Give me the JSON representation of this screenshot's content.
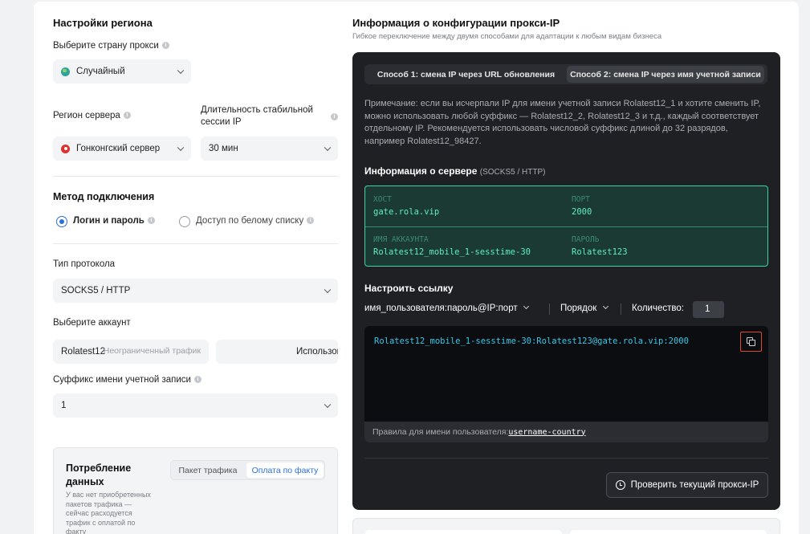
{
  "left": {
    "region_title": "Настройки региона",
    "country_label": "Выберите страну прокси",
    "country_value": "Случайный",
    "server_region_label": "Регион сервера",
    "server_region_value": "Гонконгский сервер",
    "session_label_1": "Длительность стабильной",
    "session_label_2": "сессии IP",
    "session_value": "30 мин",
    "method_title": "Метод подключения",
    "method_login": "Логин и пароль",
    "method_whitelist": "Доступ по белому списку",
    "protocol_label": "Тип протокола",
    "protocol_value": "SOCKS5 / HTTP",
    "account_label": "Выберите аккаунт",
    "account_value": "Rolatest12",
    "account_traffic": "Неограниченный трафик",
    "account_used": "Использовано",
    "suffix_label": "Суффикс имени учетной записи",
    "suffix_value": "1",
    "consumption_title_1": "Потребление",
    "consumption_title_2": "данных",
    "consumption_desc": [
      "У вас нет приобретенных",
      "пакетов трафика —",
      "сейчас расходуется",
      "трафик с оплатой по",
      "факту"
    ],
    "tab_package": "Пакет трафика",
    "tab_payg": "Оплата по факту"
  },
  "right": {
    "title": "Информация о конфигурации прокси-IP",
    "subtitle": "Гибкое переключение между двумя способами для адаптации к любым видам бизнеса",
    "method1": "Способ 1: смена IP через URL обновления",
    "method2": "Способ 2: смена IP через имя учетной записи",
    "note": "Примечание: если вы исчерпали IP для имени учетной записи Rolatest12_1 и хотите сменить IP, можно использовать любой суффикс — Rolatest12_2, Rolatest12_3 и т.д., каждый соответствует отдельному IP. Рекомендуется использовать числовой суффикс длиной до 32 разрядов, например Rolatest12_98427.",
    "server_title": "Информация о сервере",
    "server_sub": "(SOCKS5 / HTTP)",
    "host_label": "ХОСТ",
    "host_value": "gate.rola.vip",
    "port_label": "ПОРТ",
    "port_value": "2000",
    "acc_label": "ИМЯ АККАУНТА",
    "acc_value": "Rolatest12_mobile_1-sesstime-30",
    "pass_label": "ПАРОЛЬ",
    "pass_value": "Rolatest123",
    "link_title": "Настроить ссылку",
    "format": "имя_пользователя:пароль@IP:порт",
    "order": "Порядок",
    "qty_label": "Количество:",
    "qty_value": "1",
    "link_value": "Rolatest12_mobile_1-sesstime-30:Rolatest123@gate.rola.vip:2000",
    "rules_label": "Правила для имени пользователя:",
    "rules_value": "username-country",
    "check_button": "Проверить текущий прокси-IP"
  },
  "colors": {
    "accent": "#2a6fdb",
    "dark_panel": "#1e2024",
    "server_green": "#5df0bf",
    "link_cyan": "#35c7e6",
    "copy_highlight": "#e0482f"
  }
}
